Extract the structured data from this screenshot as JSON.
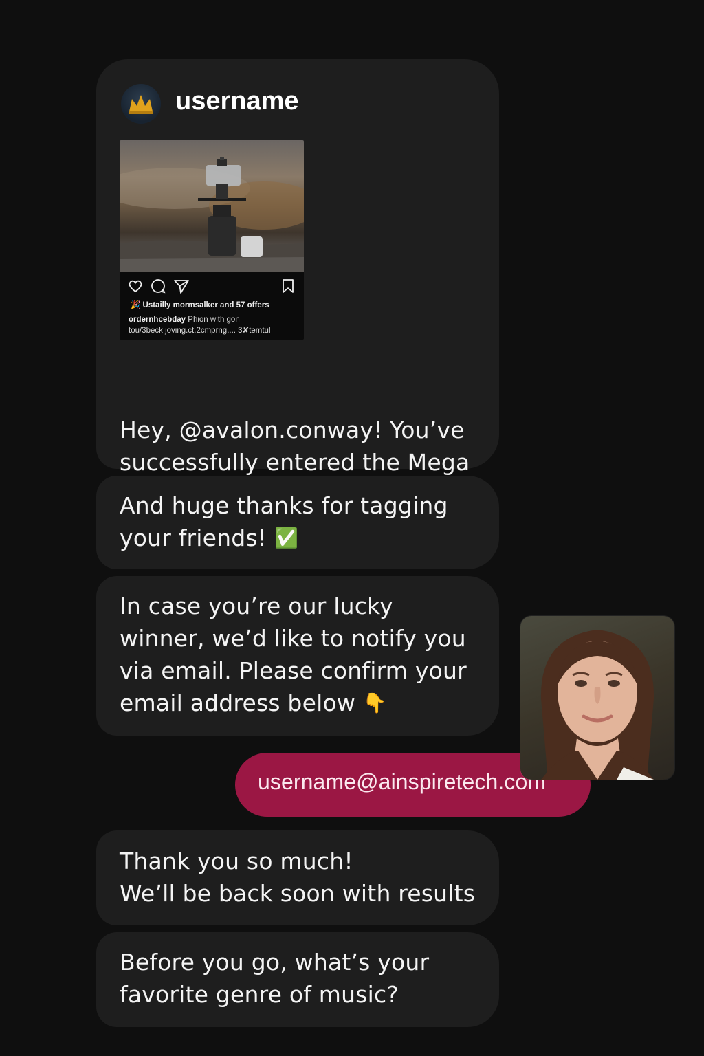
{
  "thread": {
    "sender": {
      "username": "username",
      "avatar_icon": "crown-icon"
    },
    "shared_post": {
      "likes_line": "Ustailly mormsalker and 57 offers",
      "caption_user": "ordernhcebday",
      "caption_text": "Phion with gon",
      "caption_line2": "tou/3beck joving.ct.2cmprng.... 3✘temtul",
      "icons": [
        "heart-icon",
        "comment-icon",
        "send-icon",
        "bookmark-icon"
      ]
    },
    "messages": [
      {
        "text": "Hey, @avalon.conway! You’ve\nsuccessfully entered the Mega\nJune Giveaway",
        "emoji": "🎉"
      },
      {
        "text": "And huge thanks for tagging\nyour friends!",
        "emoji": "✅"
      },
      {
        "text": "In case you’re our lucky\nwinner, we’d like to notify you\nvia email. Please confirm your\nemail address below",
        "emoji": "👇"
      },
      {
        "text": "Thank you so much!\nWe’ll be back soon with results"
      },
      {
        "text": "Before you go, what’s your\nfavorite genre of music?"
      }
    ],
    "reply": {
      "text": "username@ainspiretech.com"
    }
  },
  "colors": {
    "background": "#0f0f0f",
    "incoming_bubble": "#1e1e1e",
    "outgoing_bubble": "#9b1744"
  }
}
